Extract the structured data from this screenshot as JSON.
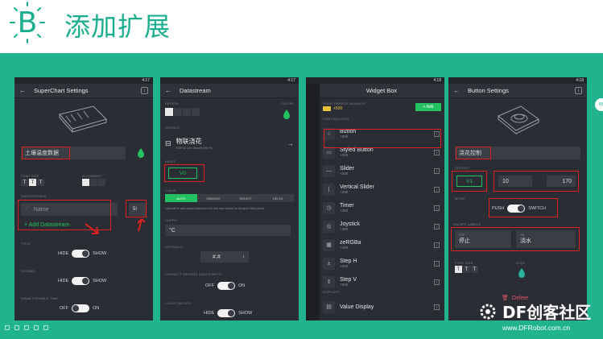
{
  "header": {
    "logo_letter": "B",
    "title": "添加扩展"
  },
  "phone1": {
    "status_time": "4:17",
    "title": "SuperChart Settings",
    "title_field": "土壤温度数据",
    "font_size_label": "FONT SIZE",
    "alignment_label": "ALIGNMENT",
    "datastreams_label": "DATASTREAMS",
    "name_placeholder": "Name",
    "add_datastream": "+ Add Datastream",
    "side_button": "5I",
    "title_label": "TITLE",
    "legend_label": "LEGEND",
    "grid_label": "DRAW FLEXIBLE TIME",
    "toggle1_off": "HIDE",
    "toggle1_on": "SHOW",
    "toggle2_off": "HIDE",
    "toggle2_on": "SHOW",
    "toggle3_off": "OFF",
    "toggle3_on": "ON"
  },
  "phone2": {
    "status_time": "4:17",
    "title": "Datastream",
    "design_label": "DESIGN",
    "color_label": "COLOR",
    "source_label": "SOURCE",
    "device_name": "物联浇花",
    "device_sub": "ESP32 Dev Board (Wi-Fi)",
    "pin_label": "INPUT",
    "pin_value": "V0",
    "ylabel_label": "Y-AXIS",
    "tabs": [
      "AUTO",
      "MIN/MAX",
      "HEIGHT",
      "DELTA"
    ],
    "help_text": "Data will be auto-scaled based on min and max values for the given time period",
    "suffix_label": "SUFFIX",
    "suffix_value": "°C",
    "decimals_label": "DECIMALS",
    "decimals_value": "#.#",
    "connect_label": "CONNECT MISSING DATA POINTS",
    "toggle1_off": "OFF",
    "toggle1_on": "ON",
    "yaxis_values_label": "Y-AXIS VALUES",
    "toggle2_off": "HIDE",
    "toggle2_on": "SHOW"
  },
  "phone3": {
    "status_time": "4:18",
    "title": "Widget Box",
    "energy_label": "YOUR ENERGY BALANCE",
    "energy_value": "+500",
    "add_button": "+ Add",
    "controllers_label": "CONTROLLERS",
    "displays_label": "DISPLAYS",
    "widgets": [
      {
        "name": "Button",
        "cost": "+200",
        "icon": "○"
      },
      {
        "name": "Styled Button",
        "cost": "+300",
        "icon": "▭"
      },
      {
        "name": "Slider",
        "cost": "+200",
        "icon": "—"
      },
      {
        "name": "Vertical Slider",
        "cost": "+200",
        "icon": "|"
      },
      {
        "name": "Timer",
        "cost": "+200",
        "icon": "◷"
      },
      {
        "name": "Joystick",
        "cost": "+400",
        "icon": "◎"
      },
      {
        "name": "zeRGBa",
        "cost": "+400",
        "icon": "▦"
      },
      {
        "name": "Step H",
        "cost": "+500",
        "icon": "±"
      },
      {
        "name": "Step V",
        "cost": "+500",
        "icon": "⇕"
      },
      {
        "name": "Value Display",
        "cost": "",
        "icon": "▤"
      }
    ]
  },
  "phone4": {
    "status_time": "4:18",
    "title": "Button Settings",
    "name_value": "浇花控制",
    "output_label": "OUTPUT",
    "pin_value": "V1",
    "range_min": "10",
    "range_max": "170",
    "mode_label": "MODE",
    "mode_push": "PUSH",
    "mode_switch": "SWITCH",
    "onoff_label": "ON/OFF LABELS",
    "off_sub": "OFF",
    "on_sub": "ON",
    "off_value": "停止",
    "on_value": "浇水",
    "font_size_label": "FONT SIZE",
    "icon_label": "ICON",
    "delete_label": "Delete"
  },
  "watermark": {
    "brand": "DF创客社区",
    "url": "www.DFRobot.com.cn"
  },
  "side_tab": "68",
  "colors": {
    "brand_green": "#1aae8e",
    "slide_green": "#20b38e",
    "phone_bg": "#2a2d33",
    "highlight_red": "#e02020",
    "accent_green": "#23c161",
    "drop_teal": "#2bb3a0"
  }
}
